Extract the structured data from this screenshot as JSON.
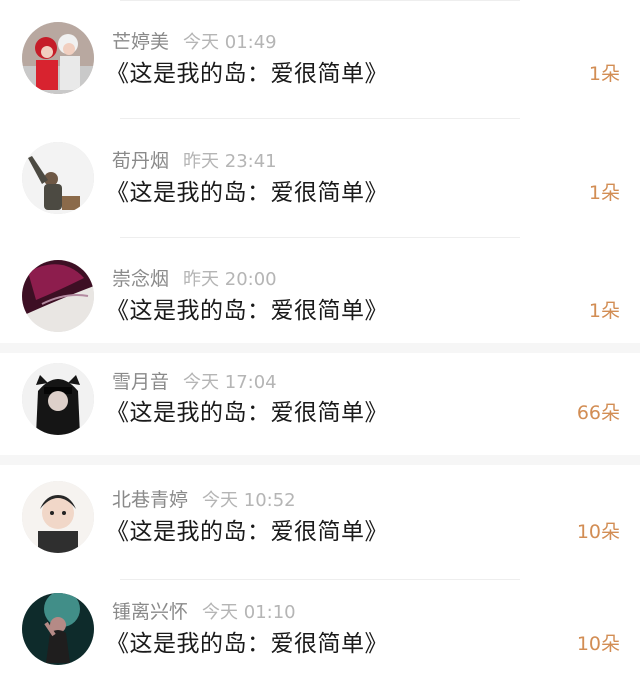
{
  "items": [
    {
      "name": "芒婷美",
      "time": "今天 01:49",
      "message": "《这是我的岛：爱很简单》",
      "count": "1朵",
      "avatar_icon": "avatar-icon"
    },
    {
      "name": "荀丹烟",
      "time": "昨天 23:41",
      "message": "《这是我的岛：爱很简单》",
      "count": "1朵",
      "avatar_icon": "avatar-icon"
    },
    {
      "name": "崇念烟",
      "time": "昨天 20:00",
      "message": "《这是我的岛：爱很简单》",
      "count": "1朵",
      "avatar_icon": "avatar-icon"
    },
    {
      "name": "雪月音",
      "time": "今天 17:04",
      "message": "《这是我的岛：爱很简单》",
      "count": "66朵",
      "avatar_icon": "avatar-icon"
    },
    {
      "name": "北巷青婷",
      "time": "今天 10:52",
      "message": "《这是我的岛：爱很简单》",
      "count": "10朵",
      "avatar_icon": "avatar-icon"
    },
    {
      "name": "锺离兴怀",
      "time": "今天 01:10",
      "message": "《这是我的岛：爱很简单》",
      "count": "10朵",
      "avatar_icon": "avatar-icon"
    }
  ],
  "colors": {
    "name": "#8a8a8a",
    "time": "#b5b5b5",
    "message": "#1a1a1a",
    "count": "#d28d54"
  }
}
